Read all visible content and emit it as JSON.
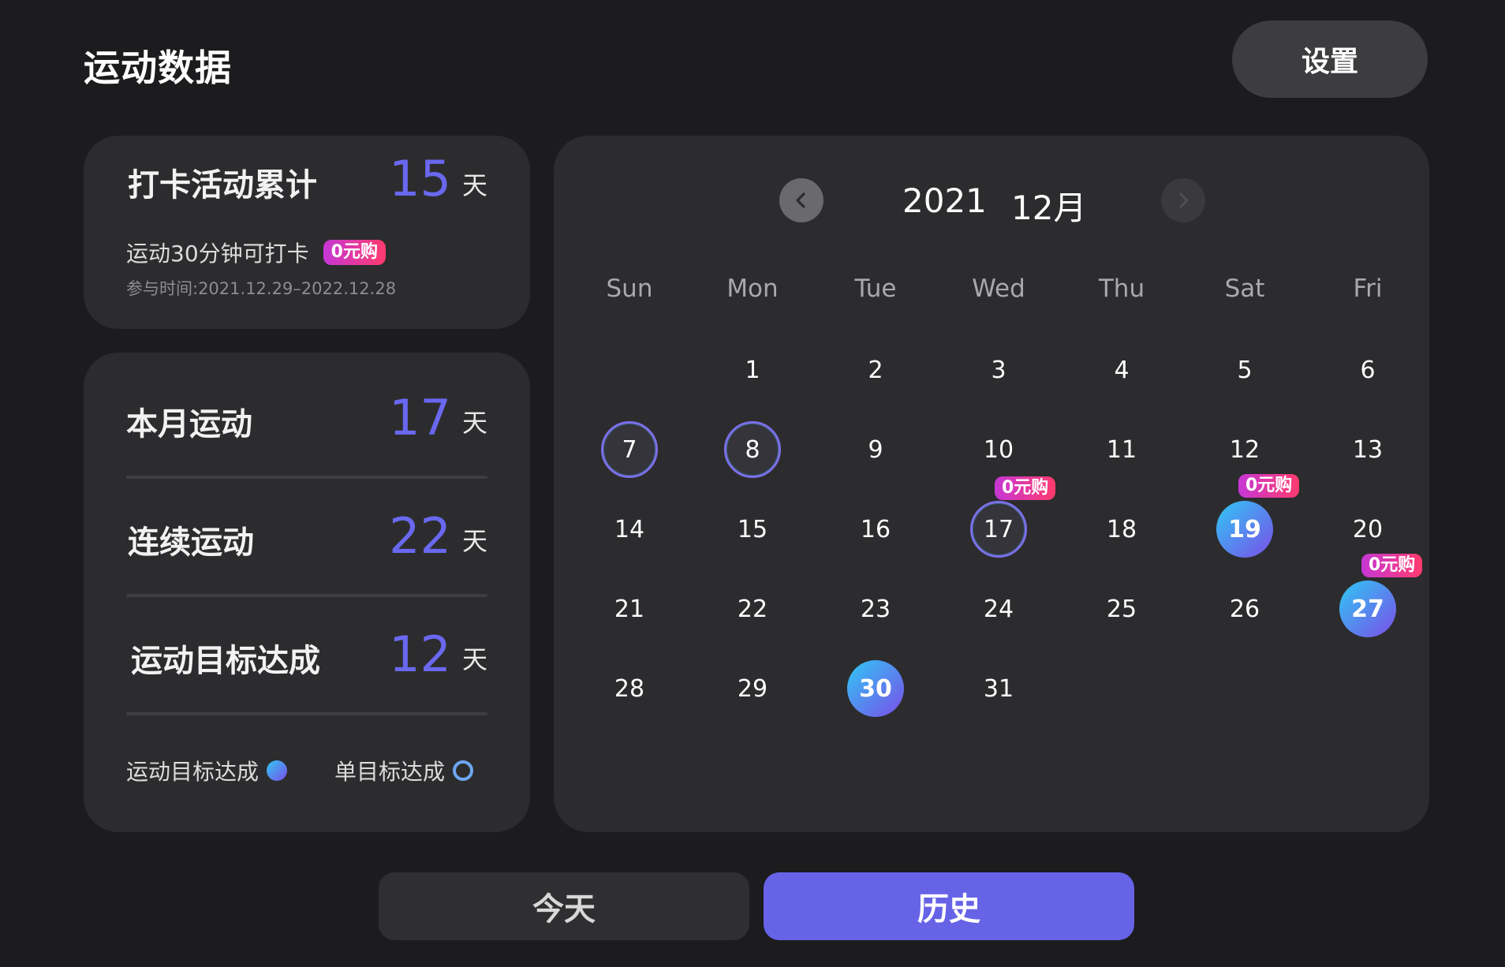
{
  "header": {
    "title": "运动数据",
    "settings_label": "设置"
  },
  "checkin": {
    "label": "打卡活动累计",
    "value": "15",
    "unit": "天",
    "subtitle": "运动30分钟可打卡",
    "promo_badge": "0元购",
    "period": "参与时间:2021.12.29–2022.12.28"
  },
  "stats": [
    {
      "label": "本月运动",
      "value": "17",
      "unit": "天"
    },
    {
      "label": "连续运动",
      "value": "22",
      "unit": "天"
    },
    {
      "label": "运动目标达成",
      "value": "12",
      "unit": "天"
    }
  ],
  "legend": {
    "goal_achieved": "运动目标达成",
    "single_goal_achieved": "单目标达成"
  },
  "calendar": {
    "year": "2021",
    "month": "12月",
    "prev_icon": "chevron-left-icon",
    "next_icon": "chevron-right-icon",
    "weekdays": [
      "Sun",
      "Mon",
      "Tue",
      "Wed",
      "Thu",
      "Sat",
      "Fri"
    ],
    "rows": [
      [
        "",
        "1",
        "2",
        "3",
        "4",
        "5",
        "6"
      ],
      [
        "7",
        "8",
        "9",
        "10",
        "11",
        "12",
        "13"
      ],
      [
        "14",
        "15",
        "16",
        "17",
        "18",
        "19",
        "20"
      ],
      [
        "21",
        "22",
        "23",
        "24",
        "25",
        "26",
        "27"
      ],
      [
        "28",
        "29",
        "30",
        "31",
        "",
        "",
        ""
      ]
    ],
    "ring_days": [
      "7",
      "8",
      "17"
    ],
    "filled_days": [
      "19",
      "27",
      "30"
    ],
    "badge_days": [
      "17",
      "19",
      "27"
    ],
    "badge_text": "0元购"
  },
  "footer": {
    "today_label": "今天",
    "history_label": "历史"
  },
  "colors": {
    "accent": "#6663e7",
    "value_text": "#6a68ef",
    "badge_gradient": [
      "#c637d6",
      "#ff3b6e"
    ],
    "day_gradient": [
      "#2fc8f5",
      "#7b4de8"
    ]
  }
}
